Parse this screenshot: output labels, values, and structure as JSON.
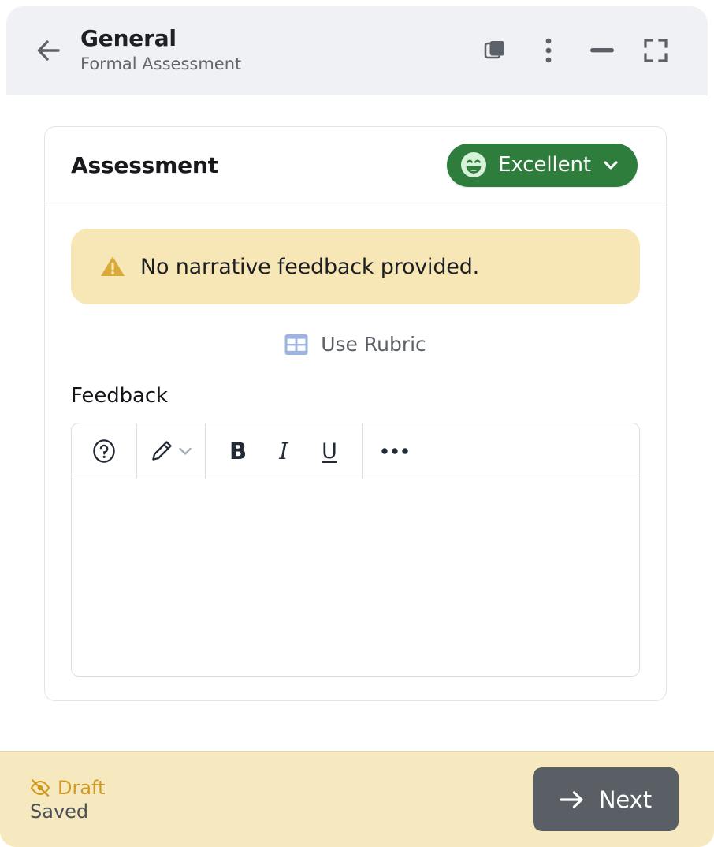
{
  "header": {
    "back_icon": "arrow-left-icon",
    "title": "General",
    "subtitle": "Formal Assessment",
    "actions": [
      {
        "icon": "copy-icon",
        "name": "duplicate-button"
      },
      {
        "icon": "more-vertical-icon",
        "name": "more-options-button"
      },
      {
        "icon": "minimize-icon",
        "name": "minimize-button"
      },
      {
        "icon": "fullscreen-icon",
        "name": "fullscreen-button"
      }
    ]
  },
  "card": {
    "title": "Assessment",
    "grade": {
      "label": "Excellent",
      "icon": "smiley-face-icon",
      "chevron": "chevron-down-icon",
      "color": "#2f7d3c",
      "text_color": "#ffffff"
    },
    "warning": {
      "icon": "warning-triangle-icon",
      "text": "No narrative feedback provided.",
      "background": "#f7e7b6",
      "icon_color": "#d9a93a"
    },
    "rubric": {
      "icon": "table-grid-icon",
      "label": "Use Rubric",
      "icon_color": "#9db4e2"
    },
    "feedback": {
      "label": "Feedback",
      "value": "",
      "placeholder": "",
      "toolbar": [
        {
          "name": "help-button",
          "icon": "help-circle-icon",
          "label": ""
        },
        {
          "name": "pencil-button",
          "icon": "pencil-icon",
          "label": ""
        },
        {
          "name": "pencil-dropdown",
          "icon": "chevron-down-icon",
          "label": ""
        },
        {
          "name": "bold-button",
          "icon": "bold-icon",
          "label": "B"
        },
        {
          "name": "italic-button",
          "icon": "italic-icon",
          "label": "I"
        },
        {
          "name": "underline-button",
          "icon": "underline-icon",
          "label": "U"
        },
        {
          "name": "more-formatting-button",
          "icon": "ellipsis-icon",
          "label": ""
        }
      ]
    }
  },
  "footer": {
    "draft_label": "Draft",
    "draft_icon": "eye-slash-icon",
    "draft_color": "#cf9a22",
    "saved_label": "Saved",
    "next_label": "Next",
    "next_icon": "arrow-right-icon",
    "background": "#f6e9bf",
    "next_color": "#5a5f66"
  }
}
